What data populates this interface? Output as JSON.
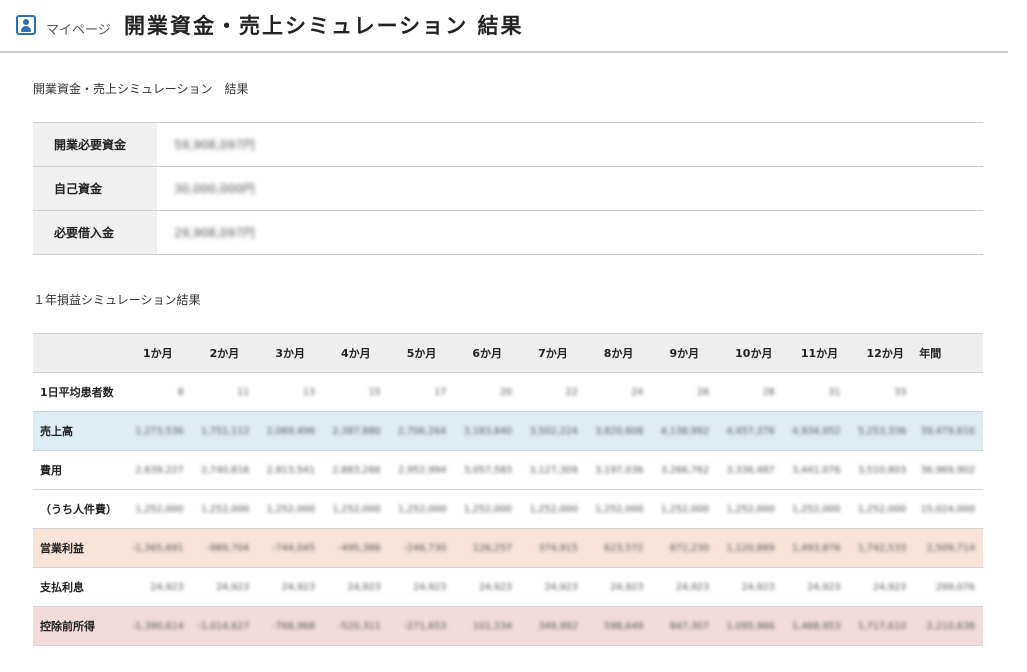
{
  "header": {
    "breadcrumb": "マイページ",
    "title": "開業資金・売上シミュレーション 結果"
  },
  "summary_section": {
    "title": "開業資金・売上シミュレーション　結果",
    "rows": [
      {
        "label": "開業必要資金",
        "value": "59,908,097円"
      },
      {
        "label": "自己資金",
        "value": "30,000,000円"
      },
      {
        "label": "必要借入金",
        "value": "29,908,097円"
      }
    ]
  },
  "pl_section": {
    "title": "１年損益シミュレーション結果",
    "columns": [
      "1か月",
      "2か月",
      "3か月",
      "4か月",
      "5か月",
      "6か月",
      "7か月",
      "8か月",
      "9か月",
      "10か月",
      "11か月",
      "12か月",
      "年間"
    ],
    "rows": [
      {
        "label": "1日平均患者数",
        "values": [
          "8",
          "11",
          "13",
          "15",
          "17",
          "20",
          "22",
          "24",
          "26",
          "28",
          "31",
          "33",
          ""
        ]
      },
      {
        "label": "売上高",
        "values": [
          "1,273,536",
          "1,751,112",
          "2,069,496",
          "2,387,880",
          "2,706,264",
          "3,183,840",
          "3,502,224",
          "3,820,608",
          "4,138,992",
          "4,457,376",
          "4,934,952",
          "5,253,336",
          "39,479,616"
        ]
      },
      {
        "label": "費用",
        "values": [
          "2,639,227",
          "2,740,816",
          "2,813,541",
          "2,883,266",
          "2,952,994",
          "3,057,583",
          "3,127,309",
          "3,197,036",
          "3,266,762",
          "3,336,487",
          "3,441,076",
          "3,510,803",
          "36,969,902"
        ]
      },
      {
        "label": "（うち人件費）",
        "values": [
          "1,252,000",
          "1,252,000",
          "1,252,000",
          "1,252,000",
          "1,252,000",
          "1,252,000",
          "1,252,000",
          "1,252,000",
          "1,252,000",
          "1,252,000",
          "1,252,000",
          "1,252,000",
          "15,024,000"
        ]
      },
      {
        "label": "営業利益",
        "values": [
          "-1,365,691",
          "-989,704",
          "-744,045",
          "-495,386",
          "-246,730",
          "126,257",
          "374,915",
          "623,572",
          "872,230",
          "1,120,889",
          "1,493,876",
          "1,742,533",
          "2,509,714"
        ]
      },
      {
        "label": "支払利息",
        "values": [
          "24,923",
          "24,923",
          "24,923",
          "24,923",
          "24,923",
          "24,923",
          "24,923",
          "24,923",
          "24,923",
          "24,923",
          "24,923",
          "24,923",
          "299,076"
        ]
      },
      {
        "label": "控除前所得",
        "values": [
          "-1,390,614",
          "-1,014,627",
          "-768,968",
          "-520,311",
          "-271,653",
          "101,334",
          "349,992",
          "598,649",
          "847,307",
          "1,095,966",
          "1,468,953",
          "1,717,610",
          "2,210,638"
        ]
      }
    ]
  }
}
